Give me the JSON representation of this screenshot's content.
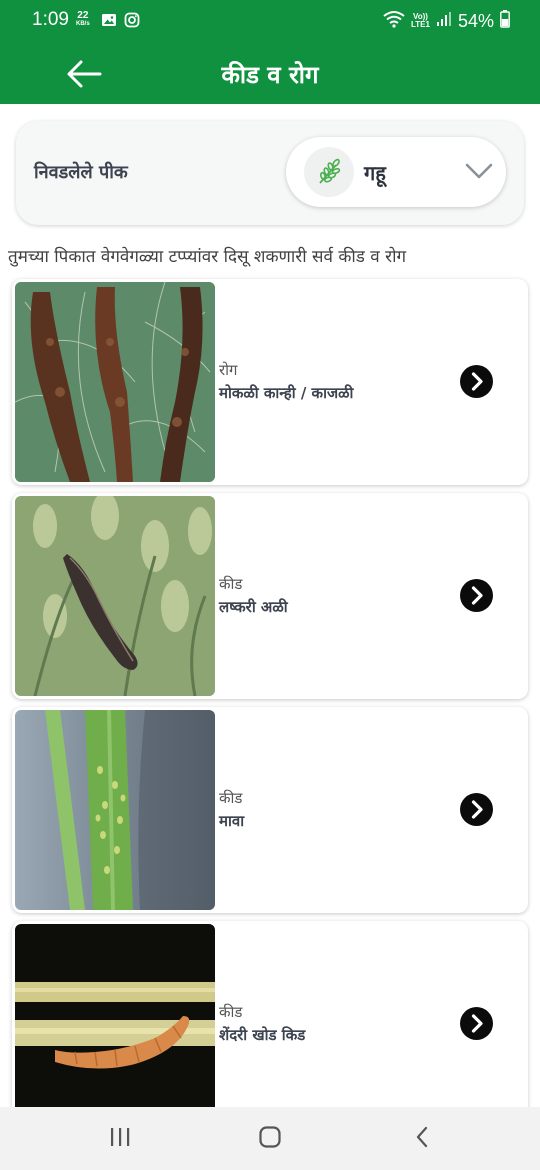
{
  "status_bar": {
    "time": "1:09",
    "net_speed_value": "22",
    "net_speed_unit": "KB/s",
    "lte_top": "Vo))",
    "lte_bottom": "LTE1",
    "battery": "54%",
    "icons": [
      "gallery-icon",
      "instagram-icon",
      "wifi-icon",
      "signal-icon",
      "battery-icon"
    ]
  },
  "app_bar": {
    "title": "कीड व रोग",
    "back_icon": "back-arrow-icon"
  },
  "crop_selector": {
    "label": "निवडलेले पीक",
    "selected": "गहू",
    "icon": "wheat-icon",
    "dropdown_icon": "chevron-down-icon"
  },
  "intro": "तुमच्या पिकात वेगवेगळ्या टप्प्यांवर दिसू शकणारी सर्व कीड व रोग",
  "items": [
    {
      "type": "रोग",
      "name": "मोकळी कान्ही / काजळी"
    },
    {
      "type": "कीड",
      "name": "लष्करी अळी"
    },
    {
      "type": "कीड",
      "name": "मावा"
    },
    {
      "type": "कीड",
      "name": "शेंदरी खोड किड"
    }
  ],
  "colors": {
    "primary_green": "#10913f",
    "arrow_black": "#0b0b0b"
  }
}
